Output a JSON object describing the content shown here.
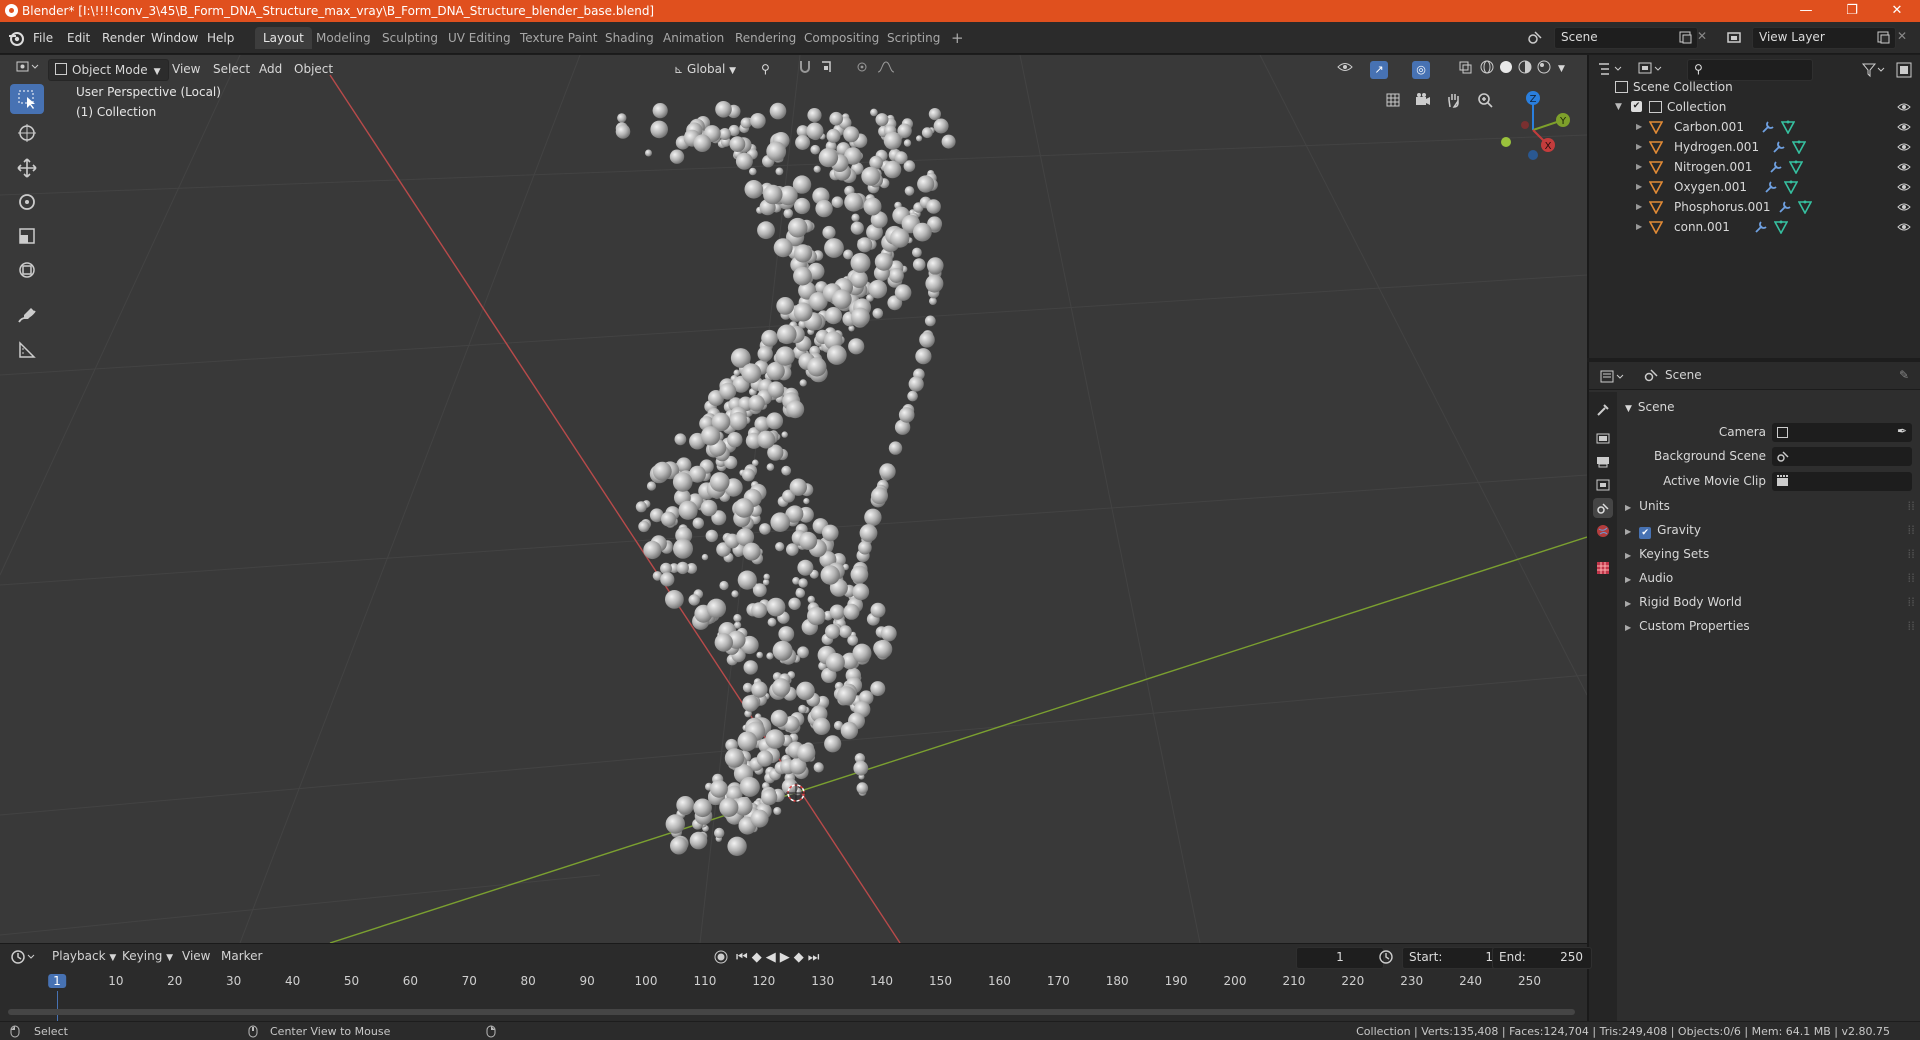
{
  "window": {
    "title": "Blender* [I:\\!!!!conv_3\\45\\B_Form_DNA_Structure_max_vray\\B_Form_DNA_Structure_blender_base.blend]",
    "minimize": "—",
    "maximize": "❐",
    "close": "✕"
  },
  "menu": {
    "file": "File",
    "edit": "Edit",
    "render": "Render",
    "window": "Window",
    "help": "Help"
  },
  "workspaces": [
    "Layout",
    "Modeling",
    "Sculpting",
    "UV Editing",
    "Texture Paint",
    "Shading",
    "Animation",
    "Rendering",
    "Compositing",
    "Scripting",
    "+"
  ],
  "scene_selector": {
    "value": "Scene"
  },
  "viewlayer_selector": {
    "value": "View Layer"
  },
  "viewport": {
    "mode": "Object Mode",
    "menus": [
      "View",
      "Select",
      "Add",
      "Object"
    ],
    "orientation": "Global",
    "overlay_line1": "User Perspective (Local)",
    "overlay_line2": "(1) Collection",
    "gizmo": {
      "z": "Z",
      "y": "Y",
      "x": "X"
    }
  },
  "outliner": {
    "root": "Scene Collection",
    "collection": "Collection",
    "items": [
      "Carbon.001",
      "Hydrogen.001",
      "Nitrogen.001",
      "Oxygen.001",
      "Phosphorus.001",
      "conn.001"
    ]
  },
  "properties": {
    "header": "Scene",
    "section": "Scene",
    "camera_label": "Camera",
    "background_label": "Background Scene",
    "movieclip_label": "Active Movie Clip",
    "subsections": [
      "Units",
      "Gravity",
      "Keying Sets",
      "Audio",
      "Rigid Body World",
      "Custom Properties"
    ],
    "gravity_checked": true
  },
  "timeline": {
    "menus": [
      "Playback",
      "Keying",
      "View",
      "Marker"
    ],
    "current_frame": "1",
    "start_label": "Start:",
    "start": "1",
    "end_label": "End:",
    "end": "250",
    "ticks": [
      "1",
      "10",
      "20",
      "30",
      "40",
      "50",
      "60",
      "70",
      "80",
      "90",
      "100",
      "110",
      "120",
      "130",
      "140",
      "150",
      "160",
      "170",
      "180",
      "190",
      "200",
      "210",
      "220",
      "230",
      "240",
      "250"
    ]
  },
  "status": {
    "select": "Select",
    "center": "Center View to Mouse",
    "stats": "Collection | Verts:135,408 | Faces:124,704 | Tris:249,408 | Objects:0/6 | Mem: 64.1 MB | v2.80.75"
  },
  "colors": {
    "accent": "#4772b3",
    "titlebar": "#e0501e",
    "x_axis": "#c43c3c",
    "y_axis": "#7ea02b",
    "z_axis": "#2a7fde",
    "object_icon": "#e08a36",
    "modifier_icon": "#6fa0e0",
    "mesh_icon": "#36c0a0"
  }
}
